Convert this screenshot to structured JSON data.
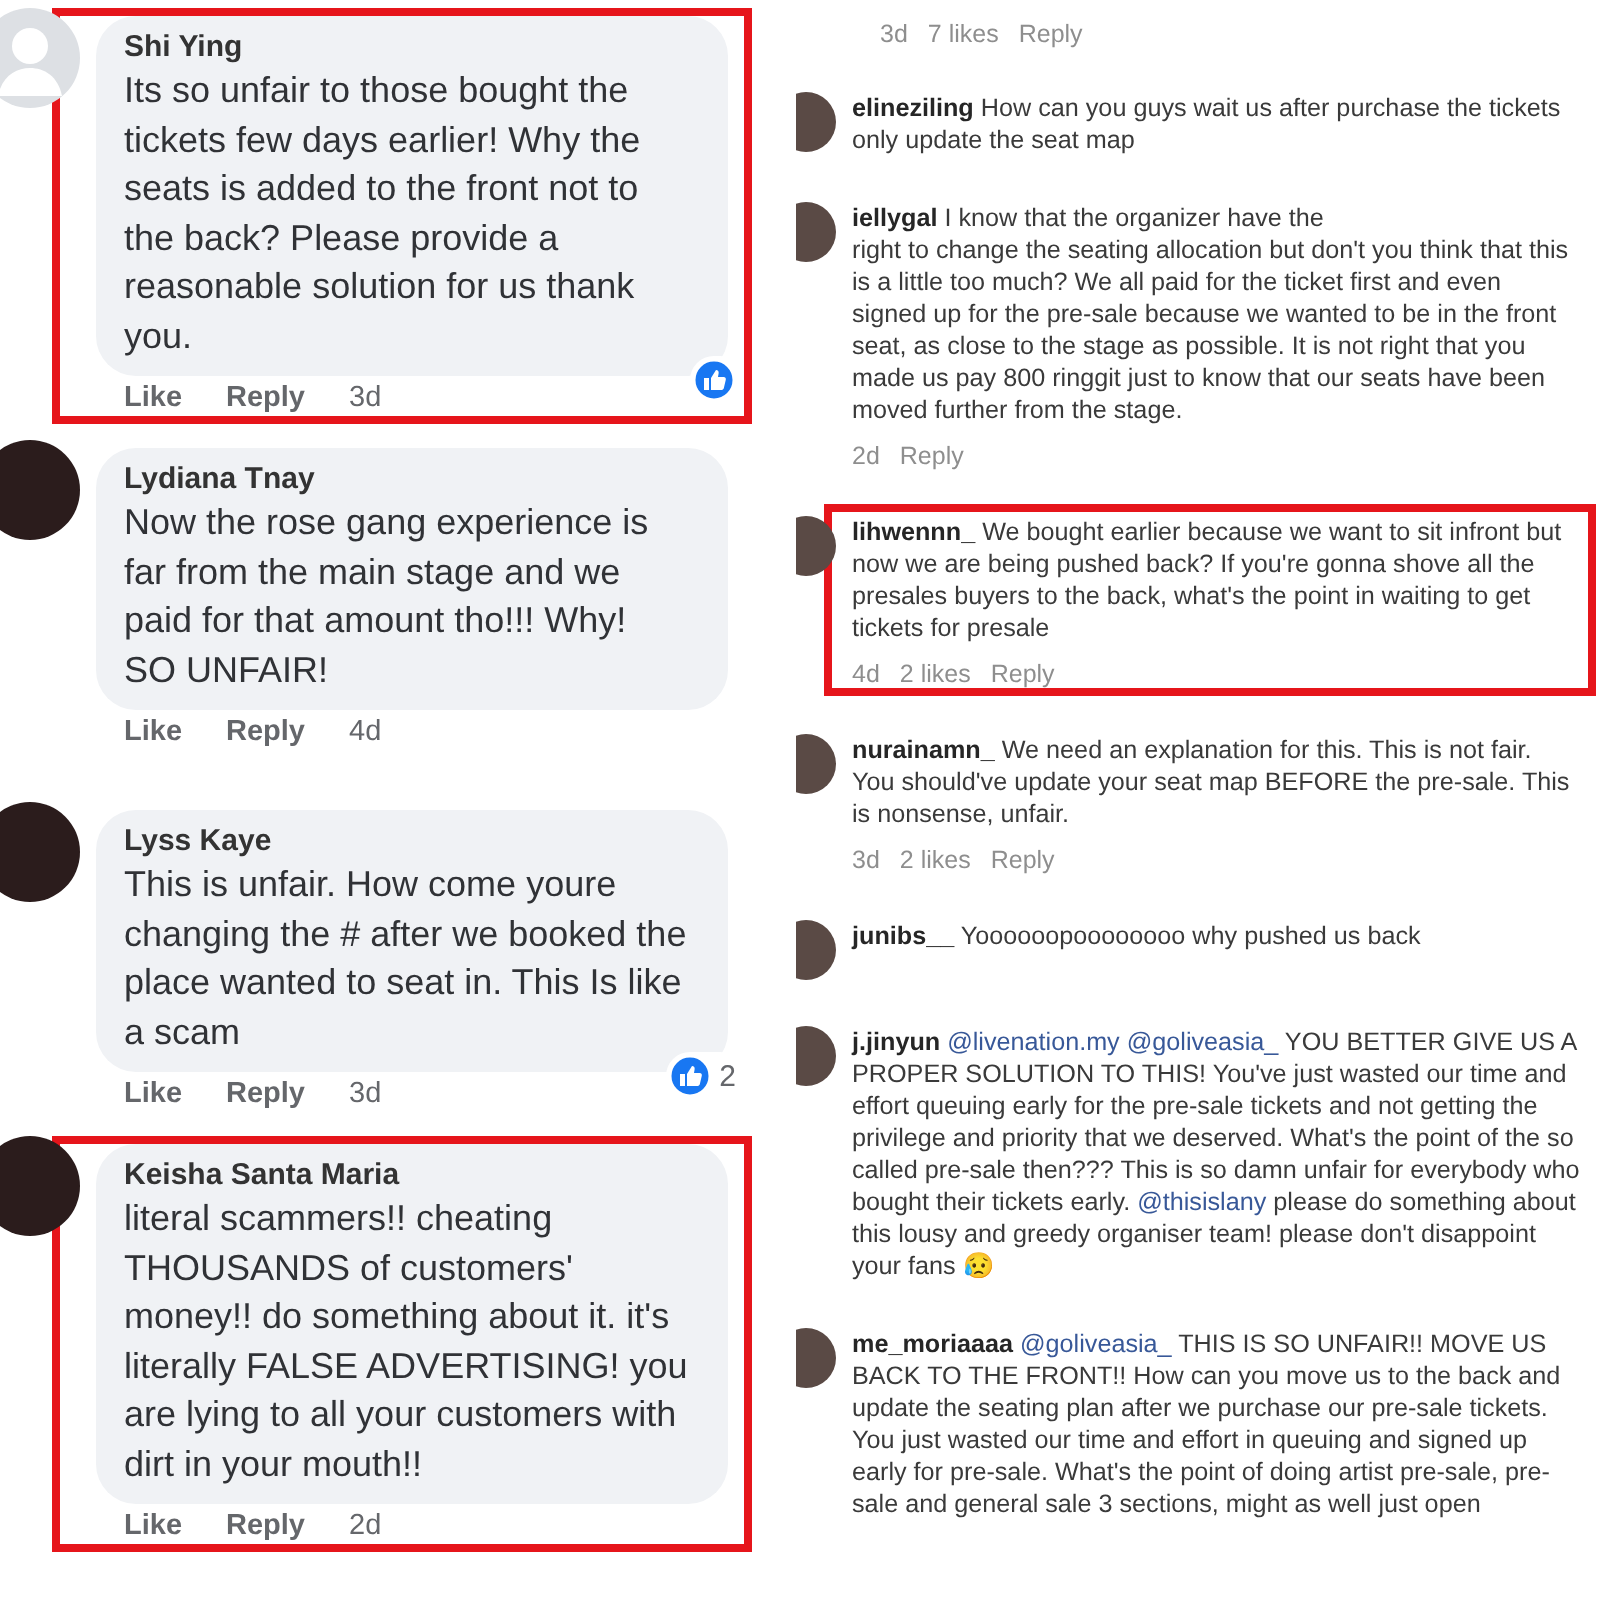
{
  "facebook_comments": [
    {
      "author": "Shi Ying",
      "default_avatar": true,
      "highlighted": true,
      "text": "Its so unfair to those bought the tickets few days earlier! Why the seats is added to the front not to the back? Please provide a reasonable solution for us thank you.",
      "reaction": true,
      "actions": [
        "Like",
        "Reply",
        "3d"
      ]
    },
    {
      "author": "Lydiana Tnay",
      "default_avatar": false,
      "highlighted": false,
      "reaction": false,
      "text": "Now the rose gang experience is far from the main stage and we paid for that amount tho!!! Why! SO UNFAIR!",
      "actions": [
        "Like",
        "Reply",
        "4d"
      ]
    },
    {
      "author": "Lyss Kaye",
      "default_avatar": false,
      "highlighted": false,
      "text": "This is unfair. How come youre changing the # after we booked the place wanted to seat in. This Is like a scam",
      "reaction": true,
      "reaction_count": "2",
      "actions": [
        "Like",
        "Reply",
        "3d"
      ]
    },
    {
      "author": "Keisha Santa Maria",
      "default_avatar": false,
      "highlighted": true,
      "reaction": false,
      "text": "literal scammers!! cheating THOUSANDS of customers' money!! do something about it. it's literally FALSE ADVERTISING! you are lying to all your customers with dirt in your mouth!!",
      "actions": [
        "Like",
        "Reply",
        "2d"
      ]
    }
  ],
  "instagram_top_meta": {
    "time": "3d",
    "likes": "7 likes",
    "reply": "Reply"
  },
  "instagram_comments": [
    {
      "author": "elineziling",
      "highlighted": false,
      "parts": [
        {
          "kind": "text",
          "text": "How can you guys wait us after purchase the tickets only update the seat map"
        }
      ]
    },
    {
      "author": "iellygal",
      "highlighted": false,
      "parts": [
        {
          "kind": "text",
          "text": "I know that the organizer have the\nright to change the seating allocation but don't you think that this is a little too much? We all paid for the ticket first and even signed up for the pre-sale because we wanted to be in the front seat, as close to the stage as possible. It is not right that you made us pay 800 ringgit just to know that our seats have been moved further from the stage."
        }
      ],
      "meta": {
        "time": "2d",
        "reply": "Reply"
      }
    },
    {
      "author": "lihwennn_",
      "highlighted": true,
      "parts": [
        {
          "kind": "text",
          "text": "We bought earlier because we want to sit infront but now we are being pushed back? If you're gonna shove all the presales buyers to the back, what's the point in waiting to get tickets for presale"
        }
      ],
      "meta": {
        "time": "4d",
        "likes": "2 likes",
        "reply": "Reply"
      }
    },
    {
      "author": "nurainamn_",
      "highlighted": false,
      "parts": [
        {
          "kind": "text",
          "text": "We need an explanation for this. This is not fair. You should've update your seat map BEFORE the pre-sale. This is nonsense, unfair."
        }
      ],
      "meta": {
        "time": "3d",
        "likes": "2 likes",
        "reply": "Reply"
      }
    },
    {
      "author": "junibs__",
      "highlighted": false,
      "parts": [
        {
          "kind": "text",
          "text": "Yoooooopoooooooo why pushed us back"
        }
      ]
    },
    {
      "author": "j.jinyun",
      "highlighted": false,
      "parts": [
        {
          "kind": "mention",
          "text": "@livenation.my"
        },
        {
          "kind": "mention",
          "text": "@goliveasia_"
        },
        {
          "kind": "text",
          "text": " YOU BETTER GIVE US A PROPER SOLUTION TO THIS! You've just wasted our time and effort queuing early for the pre-sale tickets and not getting the privilege and priority that we deserved. What's the point of the so called pre-sale then??? This is so damn unfair for everybody who bought their tickets early. "
        },
        {
          "kind": "mention",
          "text": "@thisislany"
        },
        {
          "kind": "text",
          "text": " please do something about this lousy and greedy organiser team! please don't disappoint your fans 😥"
        }
      ]
    },
    {
      "author": "me_moriaaaa",
      "highlighted": false,
      "parts": [
        {
          "kind": "mention",
          "text": "@goliveasia_"
        },
        {
          "kind": "text",
          "text": " THIS IS SO UNFAIR!! MOVE US BACK TO THE FRONT!! How can you move us to the back and update the seating plan after we purchase our pre-sale tickets. You just wasted our time and effort in queuing and signed up early for pre-sale. What's the point of doing artist pre-sale, pre-sale and general sale 3 sections, might as well just open"
        }
      ]
    }
  ]
}
